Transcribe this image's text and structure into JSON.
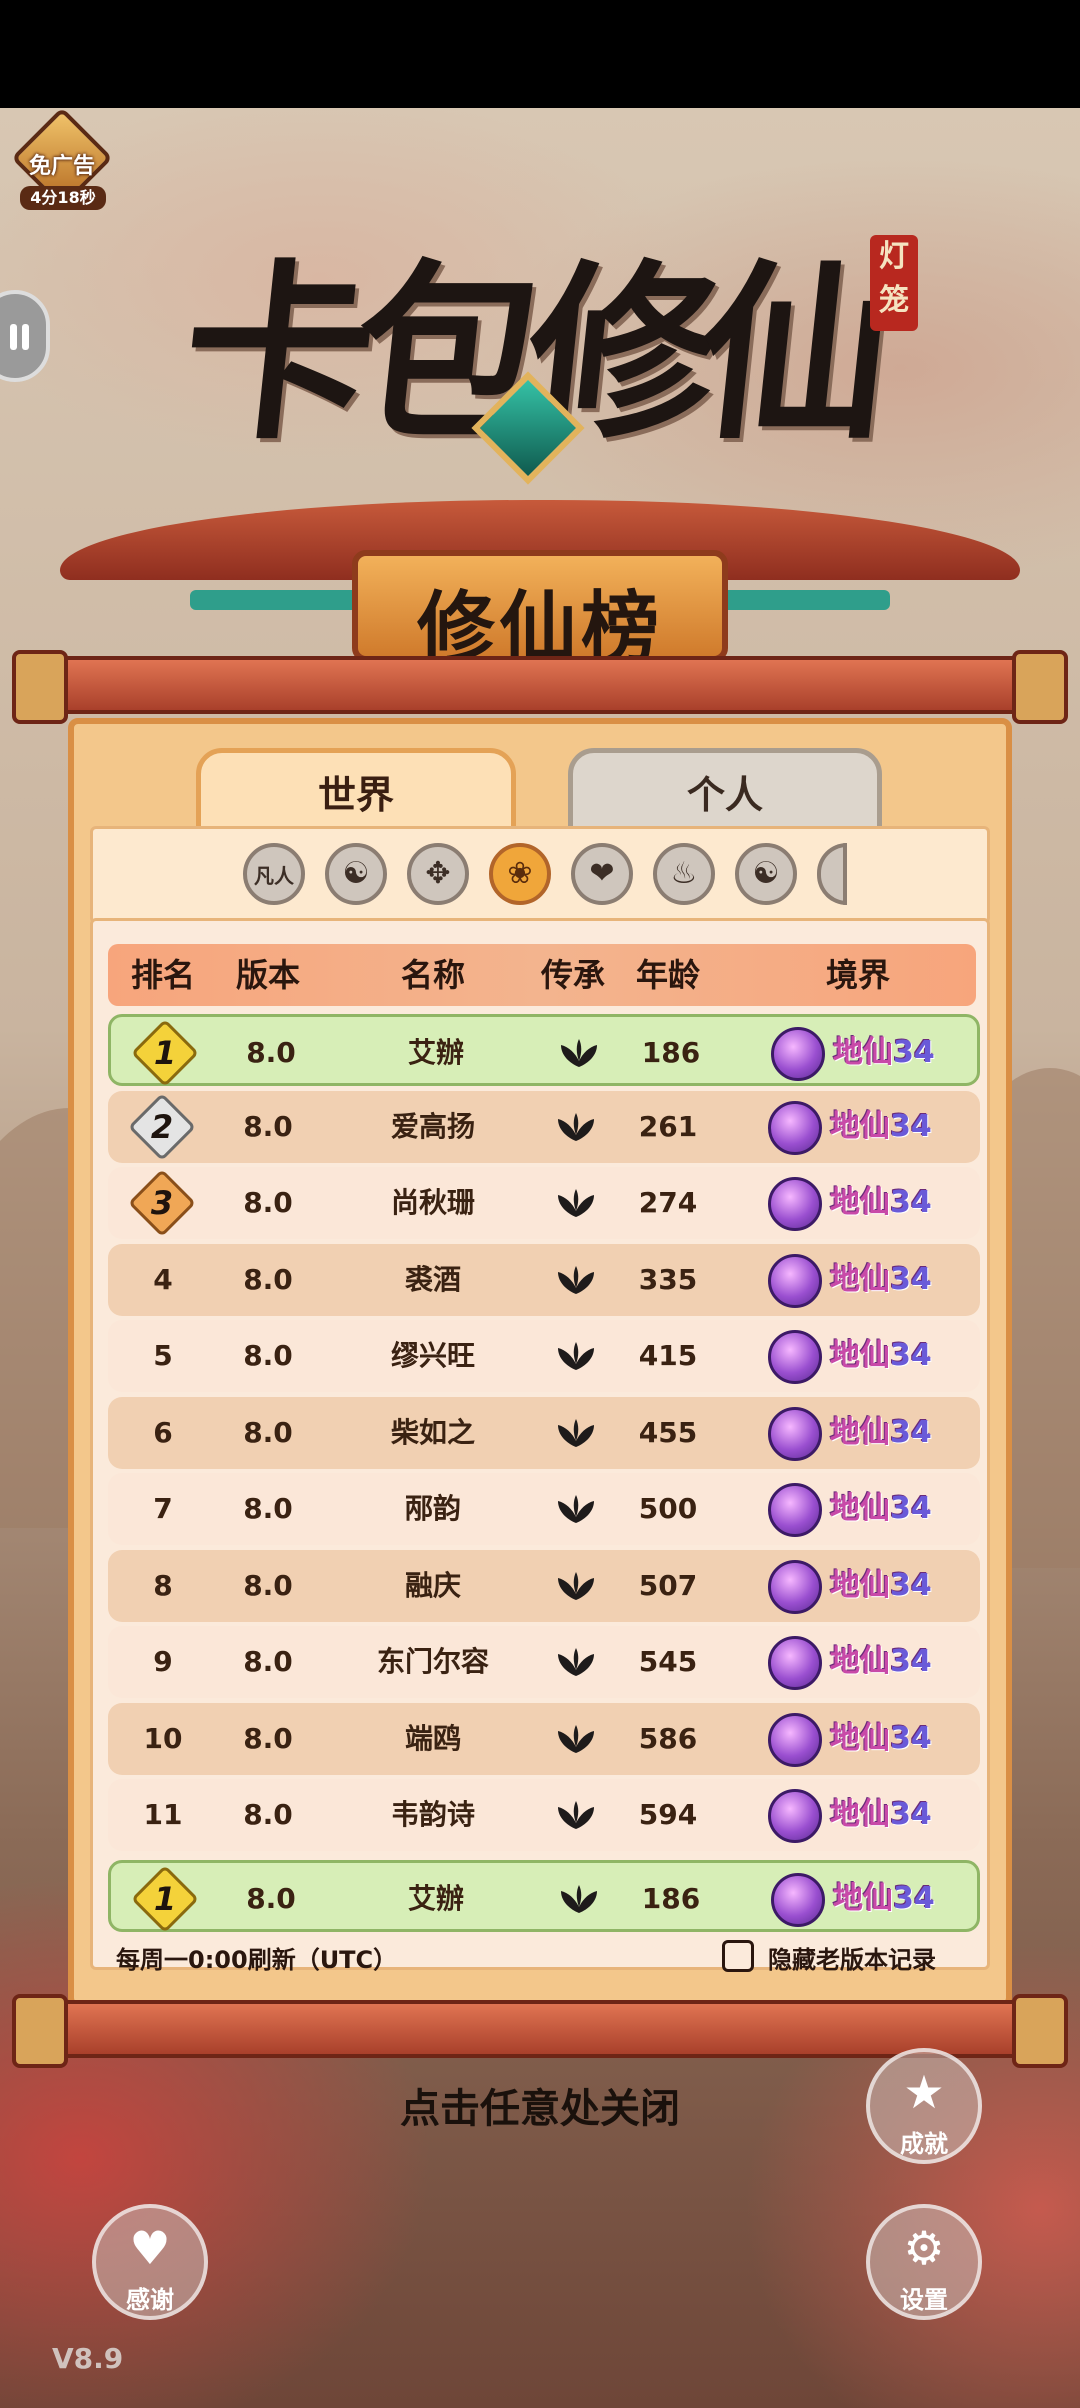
{
  "ad": {
    "label": "免广告",
    "timer": "4分18秒"
  },
  "logo": {
    "title": "卡包修仙",
    "seal": "灯笼"
  },
  "board": {
    "title": "修仙榜"
  },
  "tabs": [
    {
      "label": "世界",
      "active": true
    },
    {
      "label": "个人",
      "active": false
    }
  ],
  "categories": [
    {
      "name": "凡人",
      "icon": "text-fanren"
    },
    {
      "name": "taiji",
      "icon": "yin-yang-icon"
    },
    {
      "name": "sword",
      "icon": "sword-icon"
    },
    {
      "name": "lotus",
      "icon": "lotus-icon",
      "active": true
    },
    {
      "name": "heart",
      "icon": "heart-icon"
    },
    {
      "name": "fire",
      "icon": "fire-icon"
    },
    {
      "name": "taiji2",
      "icon": "yin-yang-icon"
    },
    {
      "name": "partial",
      "icon": "partial-icon"
    }
  ],
  "table": {
    "headers": {
      "rank": "排名",
      "version": "版本",
      "name": "名称",
      "inherit": "传承",
      "age": "年龄",
      "realm": "境界"
    },
    "rows": [
      {
        "rank": "1",
        "version": "8.0",
        "name": "艾辦",
        "age": "186",
        "realm": "地仙",
        "level": "34"
      },
      {
        "rank": "2",
        "version": "8.0",
        "name": "爱高扬",
        "age": "261",
        "realm": "地仙",
        "level": "34"
      },
      {
        "rank": "3",
        "version": "8.0",
        "name": "尚秋珊",
        "age": "274",
        "realm": "地仙",
        "level": "34"
      },
      {
        "rank": "4",
        "version": "8.0",
        "name": "裘酒",
        "age": "335",
        "realm": "地仙",
        "level": "34"
      },
      {
        "rank": "5",
        "version": "8.0",
        "name": "缪兴旺",
        "age": "415",
        "realm": "地仙",
        "level": "34"
      },
      {
        "rank": "6",
        "version": "8.0",
        "name": "柴如之",
        "age": "455",
        "realm": "地仙",
        "level": "34"
      },
      {
        "rank": "7",
        "version": "8.0",
        "name": "邴韵",
        "age": "500",
        "realm": "地仙",
        "level": "34"
      },
      {
        "rank": "8",
        "version": "8.0",
        "name": "融庆",
        "age": "507",
        "realm": "地仙",
        "level": "34"
      },
      {
        "rank": "9",
        "version": "8.0",
        "name": "东门尔容",
        "age": "545",
        "realm": "地仙",
        "level": "34"
      },
      {
        "rank": "10",
        "version": "8.0",
        "name": "端鸥",
        "age": "586",
        "realm": "地仙",
        "level": "34"
      },
      {
        "rank": "11",
        "version": "8.0",
        "name": "韦韵诗",
        "age": "594",
        "realm": "地仙",
        "level": "34"
      }
    ],
    "my_row": {
      "rank": "1",
      "version": "8.0",
      "name": "艾辦",
      "age": "186",
      "realm": "地仙",
      "level": "34"
    }
  },
  "footer": {
    "refresh_note": "每周一0:00刷新（UTC）",
    "hide_old_label": "隐藏老版本记录",
    "hide_old_checked": false
  },
  "close_hint": "点击任意处关闭",
  "buttons": {
    "achievement": "成就",
    "thanks": "感谢",
    "settings": "设置"
  },
  "version": "V8.9"
}
